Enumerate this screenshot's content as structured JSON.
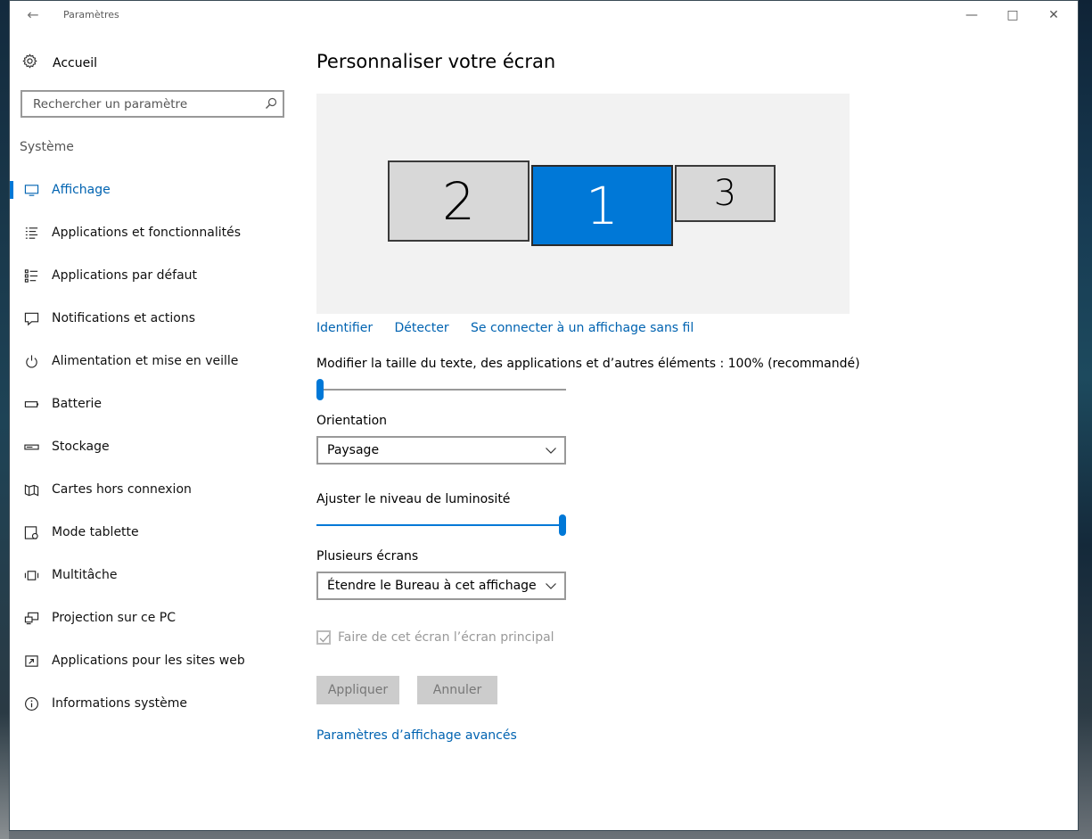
{
  "window": {
    "title": "Paramètres",
    "back_icon": "back-arrow-icon",
    "minimize_icon": "minimize-icon",
    "maximize_icon": "maximize-icon",
    "close_icon": "close-icon"
  },
  "sidebar": {
    "home_label": "Accueil",
    "home_icon": "gear-icon",
    "search_placeholder": "Rechercher un paramètre",
    "search_icon": "search-icon",
    "section_title": "Système",
    "items": [
      {
        "label": "Affichage",
        "icon": "monitor-icon",
        "active": true
      },
      {
        "label": "Applications et fonctionnalités",
        "icon": "app-list-icon"
      },
      {
        "label": "Applications par défaut",
        "icon": "default-apps-icon"
      },
      {
        "label": "Notifications et actions",
        "icon": "notification-icon"
      },
      {
        "label": "Alimentation et mise en veille",
        "icon": "power-icon"
      },
      {
        "label": "Batterie",
        "icon": "battery-icon"
      },
      {
        "label": "Stockage",
        "icon": "storage-icon"
      },
      {
        "label": "Cartes hors connexion",
        "icon": "map-icon"
      },
      {
        "label": "Mode tablette",
        "icon": "tablet-icon"
      },
      {
        "label": "Multitâche",
        "icon": "multitask-icon"
      },
      {
        "label": "Projection sur ce PC",
        "icon": "projection-icon"
      },
      {
        "label": "Applications pour les sites web",
        "icon": "web-apps-icon"
      },
      {
        "label": "Informations système",
        "icon": "info-icon"
      }
    ]
  },
  "main": {
    "title": "Personnaliser votre écran",
    "monitors": [
      {
        "number": "2",
        "selected": false
      },
      {
        "number": "1",
        "selected": true
      },
      {
        "number": "3",
        "selected": false
      }
    ],
    "links": {
      "identify": "Identifier",
      "detect": "Détecter",
      "wireless": "Se connecter à un affichage sans fil"
    },
    "scale_label": "Modifier la taille du texte, des applications et d’autres éléments : 100% (recommandé)",
    "scale_slider_value": 0,
    "orientation_label": "Orientation",
    "orientation_value": "Paysage",
    "brightness_label": "Ajuster le niveau de luminosité",
    "brightness_value": 100,
    "multi_label": "Plusieurs écrans",
    "multi_value": "Étendre le Bureau à cet affichage",
    "primary_checkbox_label": "Faire de cet écran l’écran principal",
    "primary_checked": true,
    "apply_label": "Appliquer",
    "cancel_label": "Annuler",
    "advanced_link": "Paramètres d’affichage avancés"
  },
  "colors": {
    "accent": "#0078d7",
    "link": "#0063b1",
    "disabled_button": "#cccccc"
  }
}
